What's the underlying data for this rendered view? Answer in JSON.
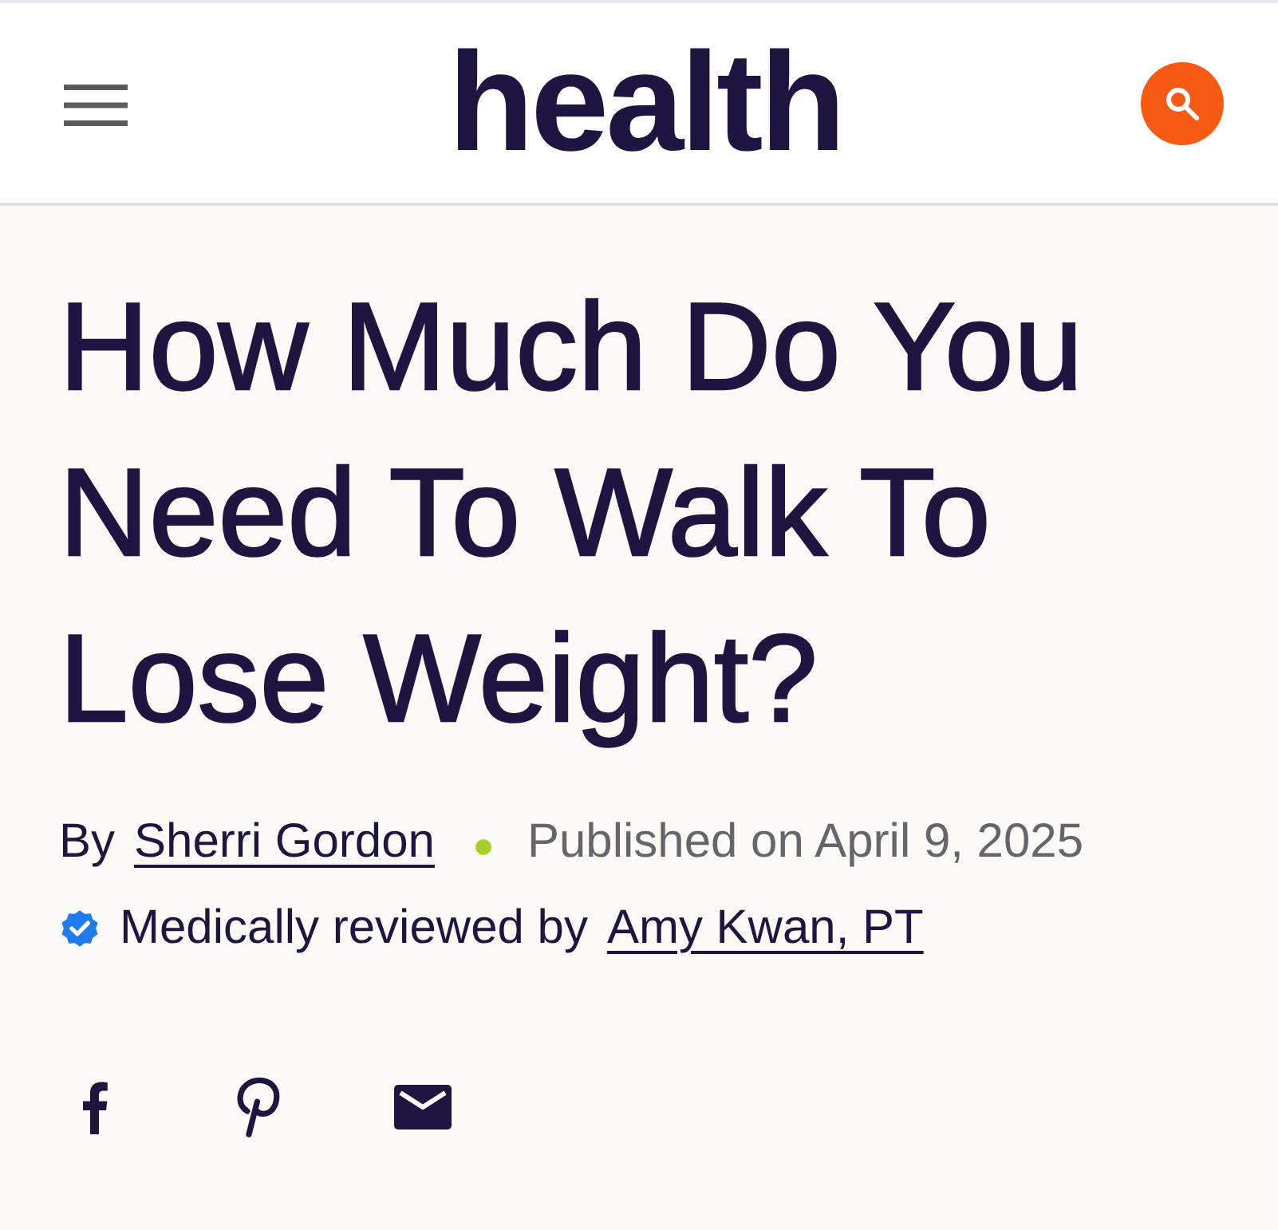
{
  "header": {
    "logo": "health"
  },
  "article": {
    "title": "How Much Do You Need To Walk To Lose Weight?",
    "byline": {
      "prefix": "By",
      "author": "Sherri Gordon",
      "published": "Published on April 9, 2025"
    },
    "review": {
      "label": "Medically reviewed by",
      "reviewer": "Amy Kwan, PT"
    }
  }
}
